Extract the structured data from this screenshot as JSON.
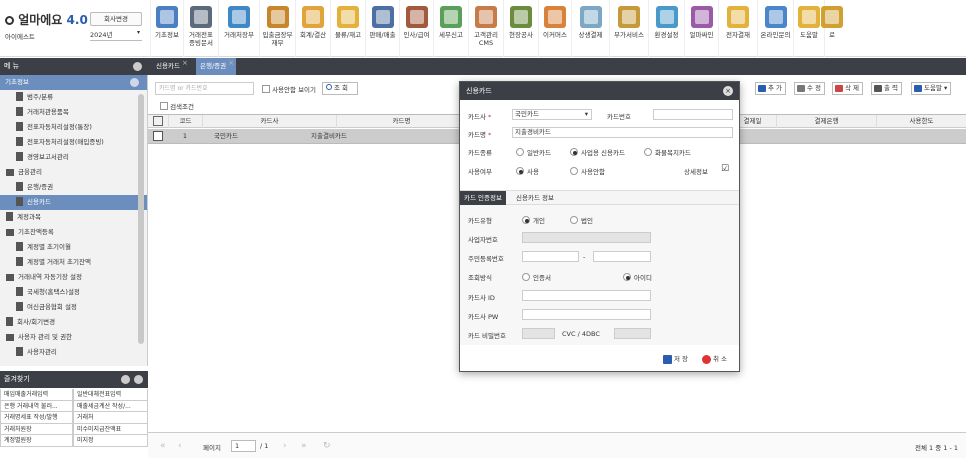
{
  "app": {
    "logo_text": "얼마에요",
    "version": "4.0",
    "company_name": "아이에스트",
    "company_change_label": "회사변경",
    "year": "2024년"
  },
  "toolbar": [
    {
      "label": "기초정보",
      "color": "#4a7fc1",
      "icon": "basic-info-icon"
    },
    {
      "label": "거래전표\n증빙문서",
      "color": "#5b6b7d",
      "icon": "voucher-icon"
    },
    {
      "label": "거래처장부",
      "color": "#3f88c5",
      "icon": "ledger-icon"
    },
    {
      "label": "입출금장부\n재무",
      "color": "#c8862a",
      "icon": "cash-ledger-icon"
    },
    {
      "label": "회계/결산",
      "color": "#e0a43a",
      "icon": "accounting-icon"
    },
    {
      "label": "물류/재고",
      "color": "#e3b23c",
      "icon": "logistics-icon"
    },
    {
      "label": "판매/매출",
      "color": "#4e6fa3",
      "icon": "sales-icon"
    },
    {
      "label": "인사/급여",
      "color": "#a35a3c",
      "icon": "hr-icon"
    },
    {
      "label": "세무신고",
      "color": "#5aa05a",
      "icon": "tax-icon"
    },
    {
      "label": "고객관리\nCMS",
      "color": "#c67b48",
      "icon": "customer-icon"
    },
    {
      "label": "현장공사",
      "color": "#6b8c3c",
      "icon": "construction-icon"
    },
    {
      "label": "이커머스",
      "color": "#d9823b",
      "icon": "ecommerce-icon"
    },
    {
      "label": "상생결제",
      "color": "#7ba8c5",
      "icon": "payment-icon"
    },
    {
      "label": "부가서비스",
      "color": "#c69a3a",
      "icon": "service-icon"
    },
    {
      "label": "환경설정",
      "color": "#4a9ac9",
      "icon": "settings-icon"
    },
    {
      "label": "얼마싸인",
      "color": "#9a5aa8",
      "icon": "sign-icon"
    },
    {
      "label": "전자결재",
      "color": "#e3b23c",
      "icon": "approval-icon"
    },
    {
      "label": "온라인문의",
      "color": "#4a86c9",
      "icon": "inquiry-icon"
    },
    {
      "label": "도움말",
      "color": "#e3b23c",
      "icon": "help-icon"
    },
    {
      "label": "로",
      "color": "#d0a030",
      "icon": "logout-icon"
    }
  ],
  "left_panel": {
    "menu_title": "메 뉴",
    "tree": [
      {
        "label": "기초정보",
        "type": "top"
      },
      {
        "label": "범주/분류",
        "indent": 14,
        "icon": "page"
      },
      {
        "label": "거래처관용품목",
        "indent": 14,
        "icon": "page"
      },
      {
        "label": "전표자동처리설정(통장)",
        "indent": 14,
        "icon": "page"
      },
      {
        "label": "전표자동처리설정(매입증빙)",
        "indent": 14,
        "icon": "page"
      },
      {
        "label": "경영보고서관리",
        "indent": 14,
        "icon": "page"
      },
      {
        "label": "금융관리",
        "indent": 4,
        "icon": "folder"
      },
      {
        "label": "은행/증권",
        "indent": 14,
        "icon": "page"
      },
      {
        "label": "신용카드",
        "indent": 14,
        "icon": "page",
        "selected": true
      },
      {
        "label": "계정과목",
        "indent": 4,
        "icon": "page"
      },
      {
        "label": "기초잔액등록",
        "indent": 4,
        "icon": "folder"
      },
      {
        "label": "계정별 초기이월",
        "indent": 14,
        "icon": "page"
      },
      {
        "label": "계정별 거래처 초기잔액",
        "indent": 14,
        "icon": "page"
      },
      {
        "label": "거래내역 자동기장 설정",
        "indent": 4,
        "icon": "folder"
      },
      {
        "label": "국세청(홈택스)설정",
        "indent": 14,
        "icon": "page"
      },
      {
        "label": "여신금융협회 설정",
        "indent": 14,
        "icon": "page"
      },
      {
        "label": "회사/회기변경",
        "indent": 4,
        "icon": "page"
      },
      {
        "label": "사용자 관리 및 권한",
        "indent": 4,
        "icon": "folder"
      },
      {
        "label": "사용자관리",
        "indent": 14,
        "icon": "page"
      }
    ],
    "favorites_title": "즐겨찾기",
    "favorites": [
      "매입매출거래입력",
      "일반대체전표입력",
      "은행 거래내역 불러...",
      "매출세금계산 작성/...",
      "거래명세표 작성/발행",
      "거래처",
      "거래처원장",
      "미수미지급잔액표",
      "계정별원장",
      "미지정"
    ]
  },
  "tabs": [
    {
      "label": "신용카드",
      "active": false
    },
    {
      "label": "은행/증권",
      "active": true
    }
  ],
  "content": {
    "search_placeholder": "카드명 or 카드번호",
    "show_unused_label": "사용안함 보이기",
    "inquire_label": "조 회",
    "search_condition_label": "검색조건",
    "buttons": {
      "add": "추 가",
      "edit": "수 정",
      "delete": "삭 제",
      "print": "출 력",
      "help": "도움말"
    },
    "columns": [
      "코드",
      "카드사",
      "카드명",
      "결제일",
      "결제은행",
      "사용한도"
    ],
    "rows": [
      {
        "code": "1",
        "card_company": "국민카드",
        "card_name": "지출결비카드",
        "pay_day": "",
        "pay_bank": "",
        "limit": ""
      }
    ],
    "pager": {
      "page_label": "페이지",
      "page": "1",
      "total_pages": "/ 1",
      "summary": "전체 1 중 1 - 1"
    }
  },
  "modal": {
    "title": "신용카드",
    "card_company_label": "카드사",
    "card_company_value": "국민카드",
    "card_number_label": "카드번호",
    "card_number_value": "",
    "card_name_label": "카드명",
    "card_name_value": "지출경비카드",
    "card_type_label": "카드종류",
    "card_type_options": [
      "일반카드",
      "사업용 신용카드",
      "화물복지카드"
    ],
    "card_type_selected": "사업용 신용카드",
    "usage_label": "사용여부",
    "usage_options": [
      "사용",
      "사용안함"
    ],
    "usage_selected": "사용",
    "detail_label": "상세정보",
    "tabs": [
      "카드 인증정보",
      "신용카드 정보"
    ],
    "auth_type_label": "카드유형",
    "auth_type_options": [
      "개인",
      "법인"
    ],
    "auth_type_selected": "개인",
    "biz_number_label": "사업자번호",
    "resident_number_label": "주민등록번호",
    "login_method_label": "조회방식",
    "login_method_options": [
      "인증서",
      "아이디"
    ],
    "login_method_selected": "아이디",
    "card_id_label": "카드사 ID",
    "card_pw_label": "카드사 PW",
    "card_pwd_label": "카드 비밀번호",
    "cvc_label": "CVC / 4DBC",
    "save_label": "저 장",
    "cancel_label": "취 소"
  }
}
